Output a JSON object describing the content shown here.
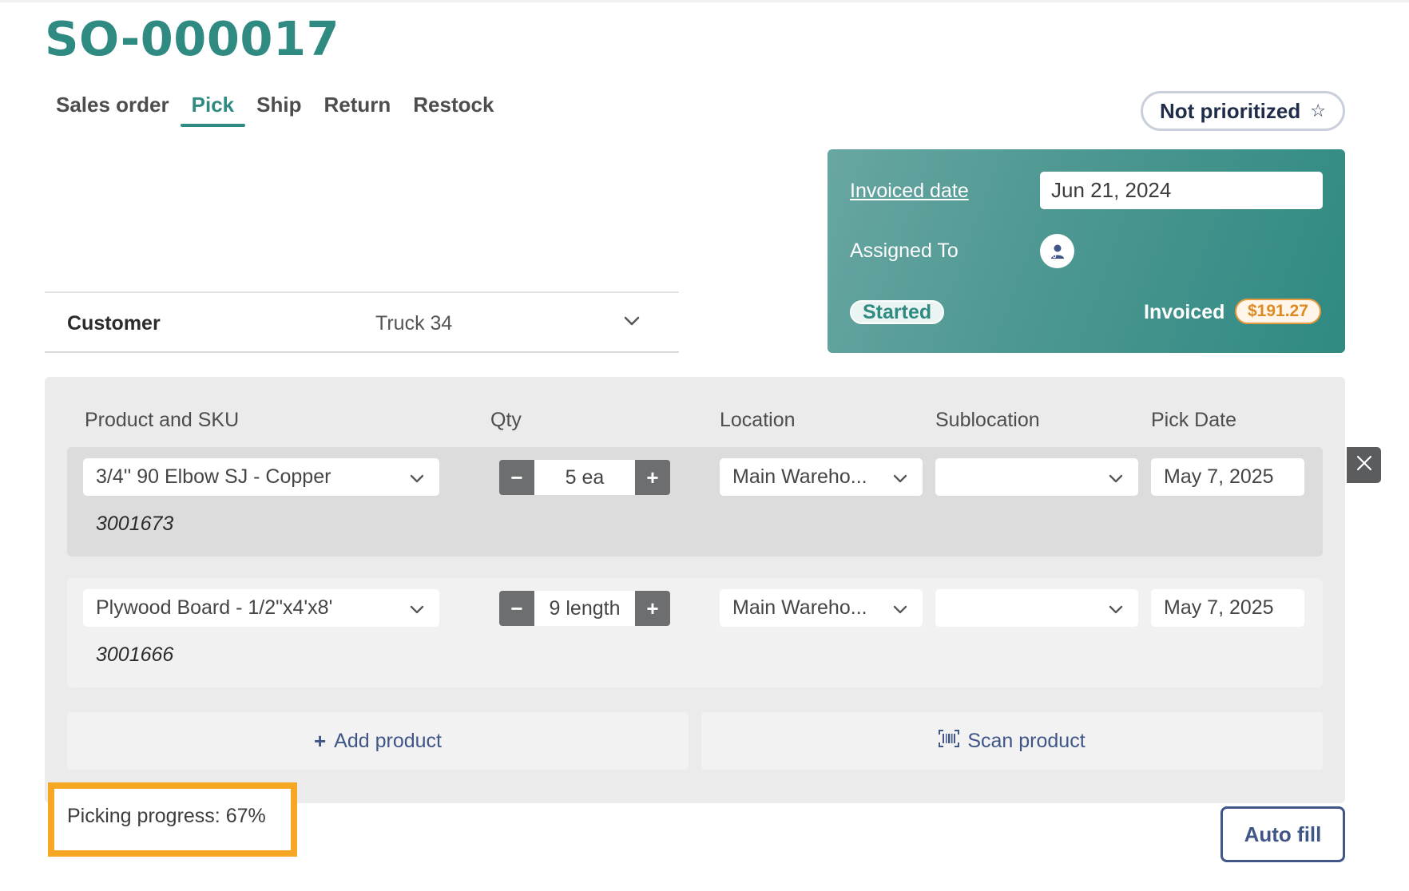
{
  "order": {
    "number": "SO-000017"
  },
  "tabs": [
    {
      "label": "Sales order",
      "active": false
    },
    {
      "label": "Pick",
      "active": true
    },
    {
      "label": "Ship",
      "active": false
    },
    {
      "label": "Return",
      "active": false
    },
    {
      "label": "Restock",
      "active": false
    }
  ],
  "priority": {
    "label": "Not prioritized",
    "icon": "star-outline-icon"
  },
  "info_card": {
    "invoiced_date_label": "Invoiced date",
    "invoiced_date_value": "Jun 21, 2024",
    "assigned_to_label": "Assigned To",
    "assigned_icon": "user-avatar-icon",
    "status": "Started",
    "invoiced_label": "Invoiced",
    "invoiced_amount": "$191.27",
    "accent": "#2f8a82",
    "amount_color": "#dd8a23"
  },
  "customer": {
    "label": "Customer",
    "value": "Truck 34"
  },
  "columns": {
    "product": "Product and SKU",
    "qty": "Qty",
    "location": "Location",
    "sublocation": "Sublocation",
    "pick_date": "Pick Date"
  },
  "lines": [
    {
      "product": "3/4'' 90 Elbow SJ - Copper",
      "sku": "3001673",
      "qty": "5 ea",
      "location": "Main Wareho...",
      "sublocation": "",
      "pick_date": "May 7, 2025"
    },
    {
      "product": "Plywood Board - 1/2\"x4'x8'",
      "sku": "3001666",
      "qty": "9 length",
      "location": "Main Wareho...",
      "sublocation": "",
      "pick_date": "May 7, 2025"
    }
  ],
  "actions": {
    "add_product": "Add product",
    "scan_product": "Scan product",
    "auto_fill": "Auto fill"
  },
  "progress": {
    "text": "Picking progress: 67%",
    "percent": 67,
    "highlight_color": "#f5a623"
  }
}
